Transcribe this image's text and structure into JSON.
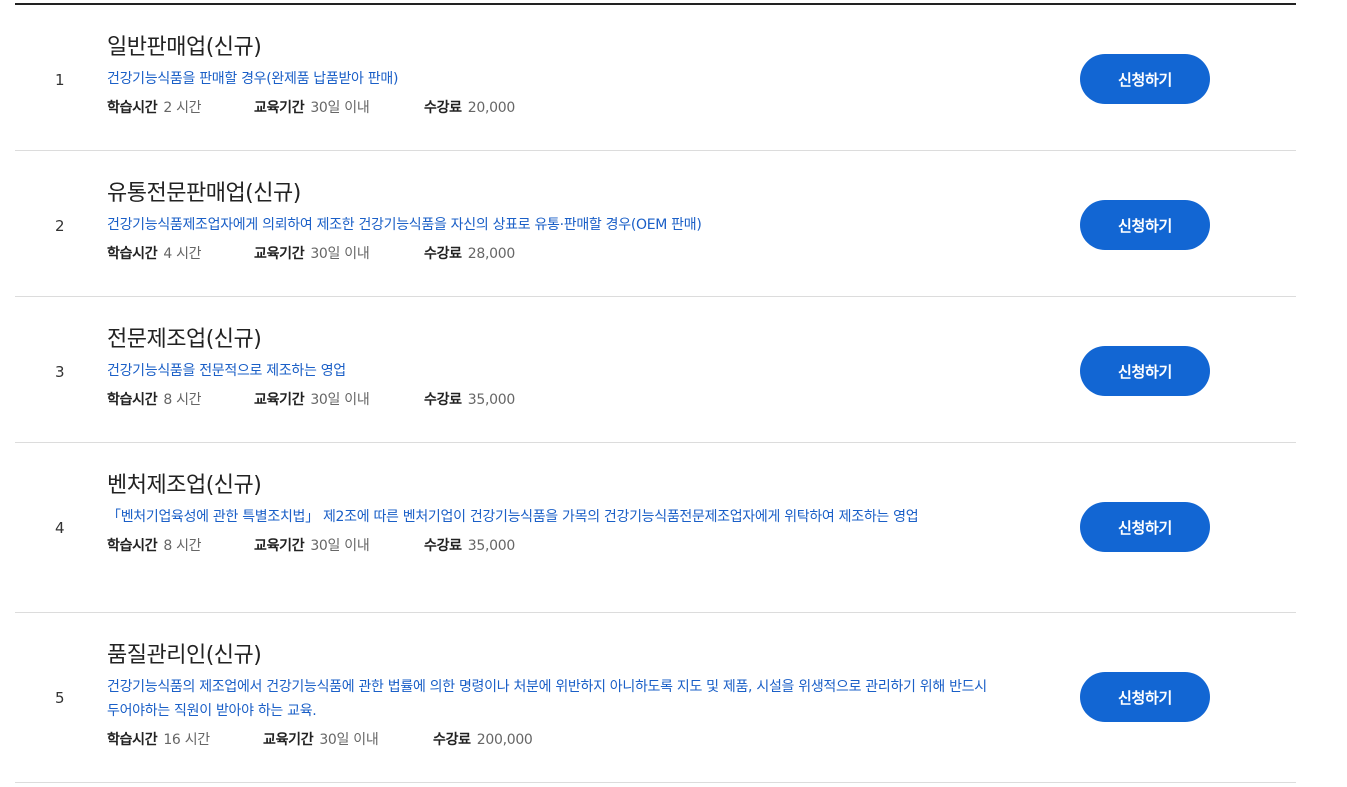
{
  "courses": [
    {
      "num": "1",
      "title": "일반판매업(신규)",
      "desc": "건강기능식품을 판매할 경우(완제품 납품받아 판매)",
      "study_time_label": "학습시간",
      "study_time": "2 시간",
      "period_label": "교육기간",
      "period": "30일 이내",
      "fee_label": "수강료",
      "fee": "20,000",
      "apply_label": "신청하기"
    },
    {
      "num": "2",
      "title": "유통전문판매업(신규)",
      "desc": "건강기능식품제조업자에게 의뢰하여 제조한 건강기능식품을 자신의 상표로 유통·판매할 경우(OEM 판매)",
      "study_time_label": "학습시간",
      "study_time": "4 시간",
      "period_label": "교육기간",
      "period": "30일 이내",
      "fee_label": "수강료",
      "fee": "28,000",
      "apply_label": "신청하기"
    },
    {
      "num": "3",
      "title": "전문제조업(신규)",
      "desc": "건강기능식품을 전문적으로 제조하는 영업",
      "study_time_label": "학습시간",
      "study_time": "8 시간",
      "period_label": "교육기간",
      "period": "30일 이내",
      "fee_label": "수강료",
      "fee": "35,000",
      "apply_label": "신청하기"
    },
    {
      "num": "4",
      "title": "벤처제조업(신규)",
      "desc": "「벤처기업육성에 관한 특별조치법」 제2조에 따른 벤처기업이 건강기능식품을 가목의 건강기능식품전문제조업자에게 위탁하여 제조하는 영업",
      "study_time_label": "학습시간",
      "study_time": "8 시간",
      "period_label": "교육기간",
      "period": "30일 이내",
      "fee_label": "수강료",
      "fee": "35,000",
      "apply_label": "신청하기"
    },
    {
      "num": "5",
      "title": "품질관리인(신규)",
      "desc": "건강기능식품의 제조업에서 건강기능식품에 관한 법률에 의한 명령이나 처분에 위반하지 아니하도록 지도 및 제품, 시설을 위생적으로 관리하기 위해 반드시 두어야하는 직원이 받아야 하는 교육.",
      "study_time_label": "학습시간",
      "study_time": "16 시간",
      "period_label": "교육기간",
      "period": "30일 이내",
      "fee_label": "수강료",
      "fee": "200,000",
      "apply_label": "신청하기"
    }
  ]
}
